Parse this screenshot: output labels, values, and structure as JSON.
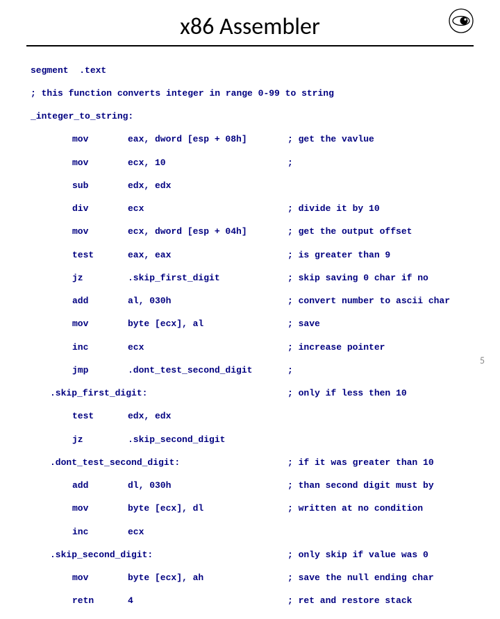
{
  "title": "x86 Assembler",
  "page_number": "5",
  "code": {
    "l1": "segment  .text",
    "l2": "; this function converts integer in range 0-99 to string",
    "l3": "_integer_to_string:",
    "r1_op": "mov",
    "r1_arg": "eax, dword [esp + 08h]",
    "r1_cmt": "; get the vavlue",
    "r2_op": "mov",
    "r2_arg": "ecx, 10",
    "r2_cmt": ";",
    "r3_op": "sub",
    "r3_arg": "edx, edx",
    "r3_cmt": "",
    "r4_op": "div",
    "r4_arg": "ecx",
    "r4_cmt": "; divide it by 10",
    "r5_op": "mov",
    "r5_arg": "ecx, dword [esp + 04h]",
    "r5_cmt": "; get the output offset",
    "r6_op": "test",
    "r6_arg": "eax, eax",
    "r6_cmt": "; is greater than 9",
    "r7_op": "jz",
    "r7_arg": ".skip_first_digit",
    "r7_cmt": "; skip saving 0 char if no",
    "r8_op": "add",
    "r8_arg": "al, 030h",
    "r8_cmt": "; convert number to ascii char",
    "r9_op": "mov",
    "r9_arg": "byte [ecx], al",
    "r9_cmt": "; save",
    "r10_op": "inc",
    "r10_arg": "ecx",
    "r10_cmt": "; increase pointer",
    "r11_op": "jmp",
    "r11_arg": ".dont_test_second_digit",
    "r11_cmt": ";",
    "lblA": ".skip_first_digit:",
    "lblA_cmt": "; only if less then 10",
    "r12_op": "test",
    "r12_arg": "edx, edx",
    "r13_op": "jz",
    "r13_arg": ".skip_second_digit",
    "lblB": ".dont_test_second_digit:",
    "lblB_cmt": "; if it was greater than 10",
    "r14_op": "add",
    "r14_arg": "dl, 030h",
    "r14_cmt": "; than second digit must by",
    "r15_op": "mov",
    "r15_arg": "byte [ecx], dl",
    "r15_cmt": "; written at no condition",
    "r16_op": "inc",
    "r16_arg": "ecx",
    "lblC": ".skip_second_digit:",
    "lblC_cmt": "; only skip if value was 0",
    "r17_op": "mov",
    "r17_arg": "byte [ecx], ah",
    "r17_cmt": "; save the null ending char",
    "r18_op": "retn",
    "r18_arg": "4",
    "r18_cmt": "; ret and restore stack"
  }
}
